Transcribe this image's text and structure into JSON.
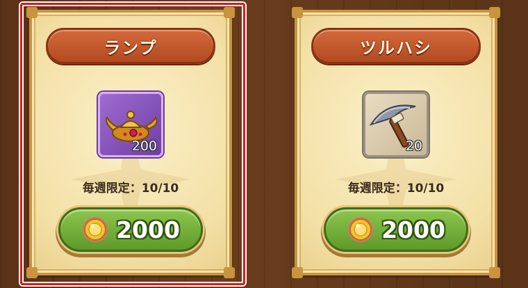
{
  "shop": {
    "items": [
      {
        "name": "ランプ",
        "icon": "magic-lamp-icon",
        "count": "200",
        "limit": "毎週限定：10/10",
        "price": "2000",
        "currency_icon": "gold-coin-icon",
        "selected": true
      },
      {
        "name": "ツルハシ",
        "icon": "pickaxe-icon",
        "count": "20",
        "limit": "毎週限定：10/10",
        "price": "2000",
        "currency_icon": "gold-coin-icon",
        "selected": false
      }
    ]
  },
  "colors": {
    "selection": "#e01818",
    "header": "#c0562c",
    "buy_button": "#6fab36"
  }
}
